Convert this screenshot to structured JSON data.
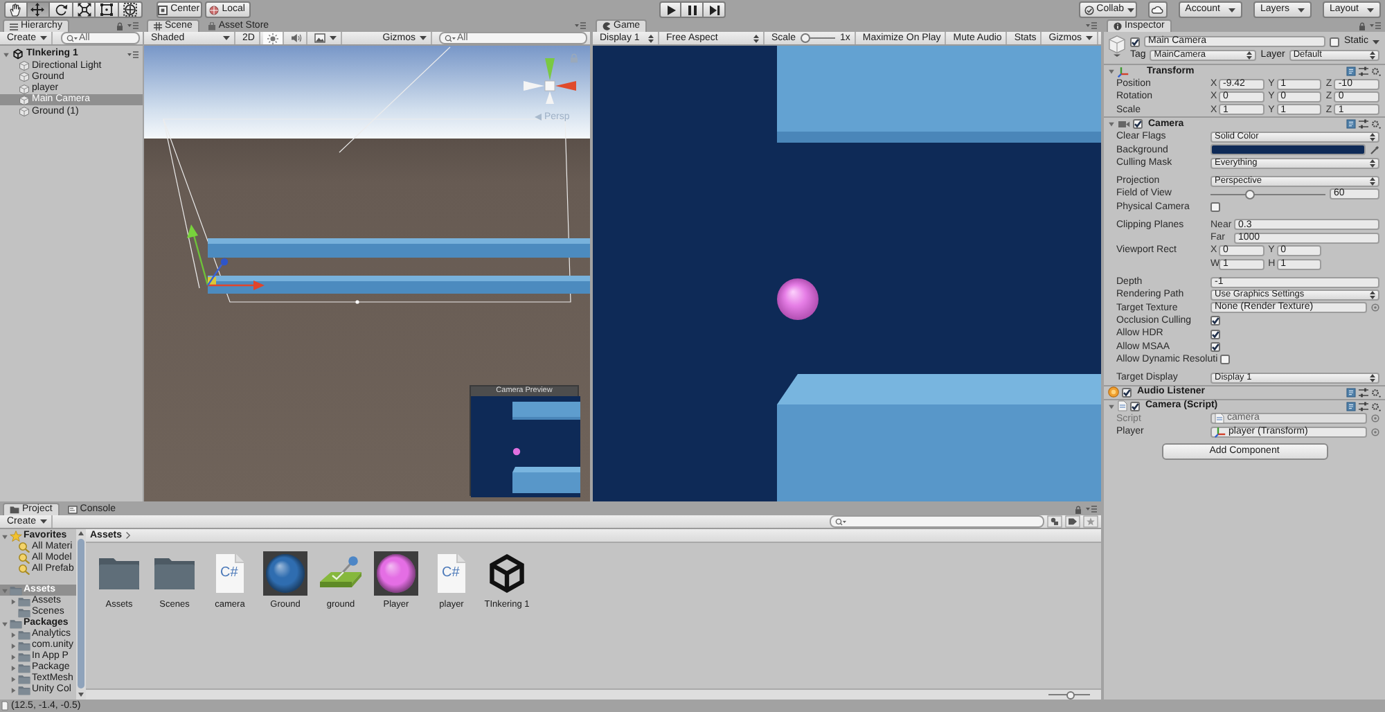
{
  "toolbar": {
    "tools": [
      {
        "kind": "hand",
        "selected": false
      },
      {
        "kind": "move",
        "selected": true
      },
      {
        "kind": "rotate",
        "selected": false
      },
      {
        "kind": "scale",
        "selected": false
      },
      {
        "kind": "rect",
        "selected": false
      },
      {
        "kind": "transform",
        "selected": false
      }
    ],
    "pivot": [
      {
        "kind": "pivot",
        "label": "Center"
      },
      {
        "kind": "space",
        "label": "Local"
      }
    ],
    "playback": [
      {
        "kind": "play"
      },
      {
        "kind": "pause"
      },
      {
        "kind": "step"
      }
    ],
    "services": [
      {
        "kind": "collab",
        "label": "Collab"
      },
      {
        "kind": "cloud"
      },
      {
        "kind": "menu",
        "label": "Account"
      },
      {
        "kind": "menu",
        "label": "Layers"
      },
      {
        "kind": "menu",
        "label": "Layout"
      }
    ]
  },
  "hierarchy": {
    "tab": "Hierarchy",
    "create": "Create",
    "search_placeholder": "All",
    "scene": {
      "label": "TInkering 1",
      "expanded": true
    },
    "items": [
      {
        "label": "Directional Light",
        "selected": false
      },
      {
        "label": "Ground",
        "selected": false
      },
      {
        "label": "player",
        "selected": false
      },
      {
        "label": "Main Camera",
        "selected": true
      },
      {
        "label": "Ground (1)",
        "selected": false
      }
    ]
  },
  "scene_view": {
    "tabs": [
      {
        "kind": "scene",
        "label": "Scene",
        "selected": true
      },
      {
        "kind": "store",
        "label": "Asset Store",
        "selected": false
      }
    ],
    "shading": "Shaded",
    "toggles": [
      {
        "kind": "mode",
        "label": "2D",
        "on": false
      },
      {
        "kind": "lighting",
        "on": true
      },
      {
        "kind": "audio",
        "on": false
      },
      {
        "kind": "effects",
        "on": false
      }
    ],
    "gizmos": "Gizmos",
    "search_placeholder": "All",
    "projection_label": "Persp",
    "camera_preview": {
      "title": "Camera Preview"
    }
  },
  "game_view": {
    "tab": "Game",
    "display": "Display 1",
    "aspect": "Free Aspect",
    "scale": {
      "label": "Scale",
      "level": 0,
      "reading": "1x"
    },
    "toggles": [
      {
        "label": "Maximize On Play",
        "on": false
      },
      {
        "label": "Mute Audio",
        "on": false
      },
      {
        "label": "Stats",
        "on": false
      }
    ],
    "gizmos": "Gizmos"
  },
  "inspector": {
    "tab": "Inspector",
    "object": {
      "active": true,
      "name": "Main Camera",
      "static": {
        "label": "Static",
        "checked": false
      },
      "tag": {
        "label": "Tag",
        "value": "MainCamera"
      },
      "layer": {
        "label": "Layer",
        "value": "Default"
      }
    },
    "components": [
      {
        "kind": "transform",
        "title": "Transform",
        "expanded": true,
        "sections": [
          [
            {
              "kind": "vector",
              "label": "Position",
              "fields": [
                {
                  "axis": "X",
                  "value": "-9.42"
                },
                {
                  "axis": "Y",
                  "value": "1"
                },
                {
                  "axis": "Z",
                  "value": "-10"
                }
              ]
            },
            {
              "kind": "vector",
              "label": "Rotation",
              "fields": [
                {
                  "axis": "X",
                  "value": "0"
                },
                {
                  "axis": "Y",
                  "value": "0"
                },
                {
                  "axis": "Z",
                  "value": "0"
                }
              ]
            },
            {
              "kind": "vector",
              "label": "Scale",
              "fields": [
                {
                  "axis": "X",
                  "value": "1"
                },
                {
                  "axis": "Y",
                  "value": "1"
                },
                {
                  "axis": "Z",
                  "value": "1"
                }
              ]
            }
          ]
        ]
      },
      {
        "kind": "camera",
        "title": "Camera",
        "enabled": true,
        "expanded": true,
        "sections": [
          [
            {
              "kind": "dropdown",
              "label": "Clear Flags",
              "value": "Solid Color"
            },
            {
              "kind": "color",
              "label": "Background",
              "color": "#0e2a57"
            },
            {
              "kind": "dropdown",
              "label": "Culling Mask",
              "value": "Everything"
            }
          ],
          [
            {
              "kind": "dropdown",
              "label": "Projection",
              "value": "Perspective"
            },
            {
              "kind": "slider",
              "label": "Field of View",
              "level": 0.33,
              "value": "60"
            },
            {
              "kind": "checkbox",
              "label": "Physical Camera",
              "checked": false
            }
          ],
          [
            {
              "kind": "stack",
              "label": "Clipping Planes",
              "fields": [
                {
                  "axis": "Near",
                  "value": "0.3"
                },
                {
                  "axis": "Far",
                  "value": "1000"
                }
              ]
            },
            {
              "kind": "rect",
              "label": "Viewport Rect",
              "fields": [
                {
                  "axis": "X",
                  "value": "0"
                },
                {
                  "axis": "Y",
                  "value": "0"
                },
                {
                  "axis": "W",
                  "value": "1"
                },
                {
                  "axis": "H",
                  "value": "1"
                }
              ]
            }
          ],
          [
            {
              "kind": "text",
              "label": "Depth",
              "value": "-1"
            },
            {
              "kind": "dropdown",
              "label": "Rendering Path",
              "value": "Use Graphics Settings"
            },
            {
              "kind": "object",
              "label": "Target Texture",
              "value": "None (Render Texture)"
            },
            {
              "kind": "checkbox",
              "label": "Occlusion Culling",
              "checked": true
            },
            {
              "kind": "checkbox",
              "label": "Allow HDR",
              "checked": true
            },
            {
              "kind": "checkbox",
              "label": "Allow MSAA",
              "checked": true
            },
            {
              "kind": "checkbox",
              "label": "Allow Dynamic Resoluti",
              "checked": false
            }
          ],
          [
            {
              "kind": "dropdown",
              "label": "Target Display",
              "value": "Display 1"
            }
          ]
        ]
      },
      {
        "kind": "audio",
        "title": "Audio Listener",
        "enabled": true
      },
      {
        "kind": "script",
        "title": "Camera (Script)",
        "enabled": true,
        "expanded": true,
        "sections": [
          [
            {
              "kind": "script",
              "label": "Script",
              "value": "camera"
            },
            {
              "kind": "reference",
              "label": "Player",
              "value": "player (Transform)"
            }
          ]
        ]
      }
    ],
    "add_button": "Add Component"
  },
  "project": {
    "tabs": [
      {
        "kind": "project",
        "label": "Project",
        "selected": true
      },
      {
        "kind": "console",
        "label": "Console",
        "selected": false
      }
    ],
    "create": "Create",
    "tree": [
      {
        "kind": "favorites",
        "label": "Favorites",
        "expanded": true,
        "selected": false,
        "children": [
          {
            "kind": "search",
            "label": "All Materi",
            "selected": false
          },
          {
            "kind": "search",
            "label": "All Model",
            "selected": false
          },
          {
            "kind": "search",
            "label": "All Prefab",
            "selected": false
          }
        ]
      },
      {
        "kind": "folder",
        "label": "Assets",
        "expanded": true,
        "selected": true,
        "children": [
          {
            "kind": "folder",
            "label": "Assets",
            "expanded": false,
            "selected": false
          },
          {
            "kind": "folder",
            "label": "Scenes",
            "selected": false
          }
        ]
      },
      {
        "kind": "folder",
        "label": "Packages",
        "expanded": true,
        "selected": false,
        "children": [
          {
            "kind": "folder",
            "label": "Analytics",
            "expanded": false,
            "selected": false
          },
          {
            "kind": "folder",
            "label": "com.unity",
            "expanded": false,
            "selected": false
          },
          {
            "kind": "folder",
            "label": "In App P",
            "expanded": false,
            "selected": false
          },
          {
            "kind": "folder",
            "label": "Package",
            "expanded": false,
            "selected": false
          },
          {
            "kind": "folder",
            "label": "TextMesh",
            "expanded": false,
            "selected": false
          },
          {
            "kind": "folder",
            "label": "Unity Col",
            "expanded": false,
            "selected": false
          }
        ]
      }
    ],
    "path": [
      "Assets"
    ],
    "assets": [
      {
        "kind": "folder",
        "label": "Assets"
      },
      {
        "kind": "folder",
        "label": "Scenes"
      },
      {
        "kind": "script",
        "label": "camera",
        "badge": "C#"
      },
      {
        "kind": "material",
        "label": "Ground",
        "color": "#2f6db0"
      },
      {
        "kind": "physic",
        "label": "ground"
      },
      {
        "kind": "material",
        "label": "Player",
        "color": "#e46ee4"
      },
      {
        "kind": "script",
        "label": "player",
        "badge": "C#"
      },
      {
        "kind": "scene",
        "label": "TInkering 1"
      }
    ],
    "zoom": {
      "level": 0.55
    }
  },
  "status_bar": {
    "text": "(12.5, -1.4, -0.5)"
  }
}
